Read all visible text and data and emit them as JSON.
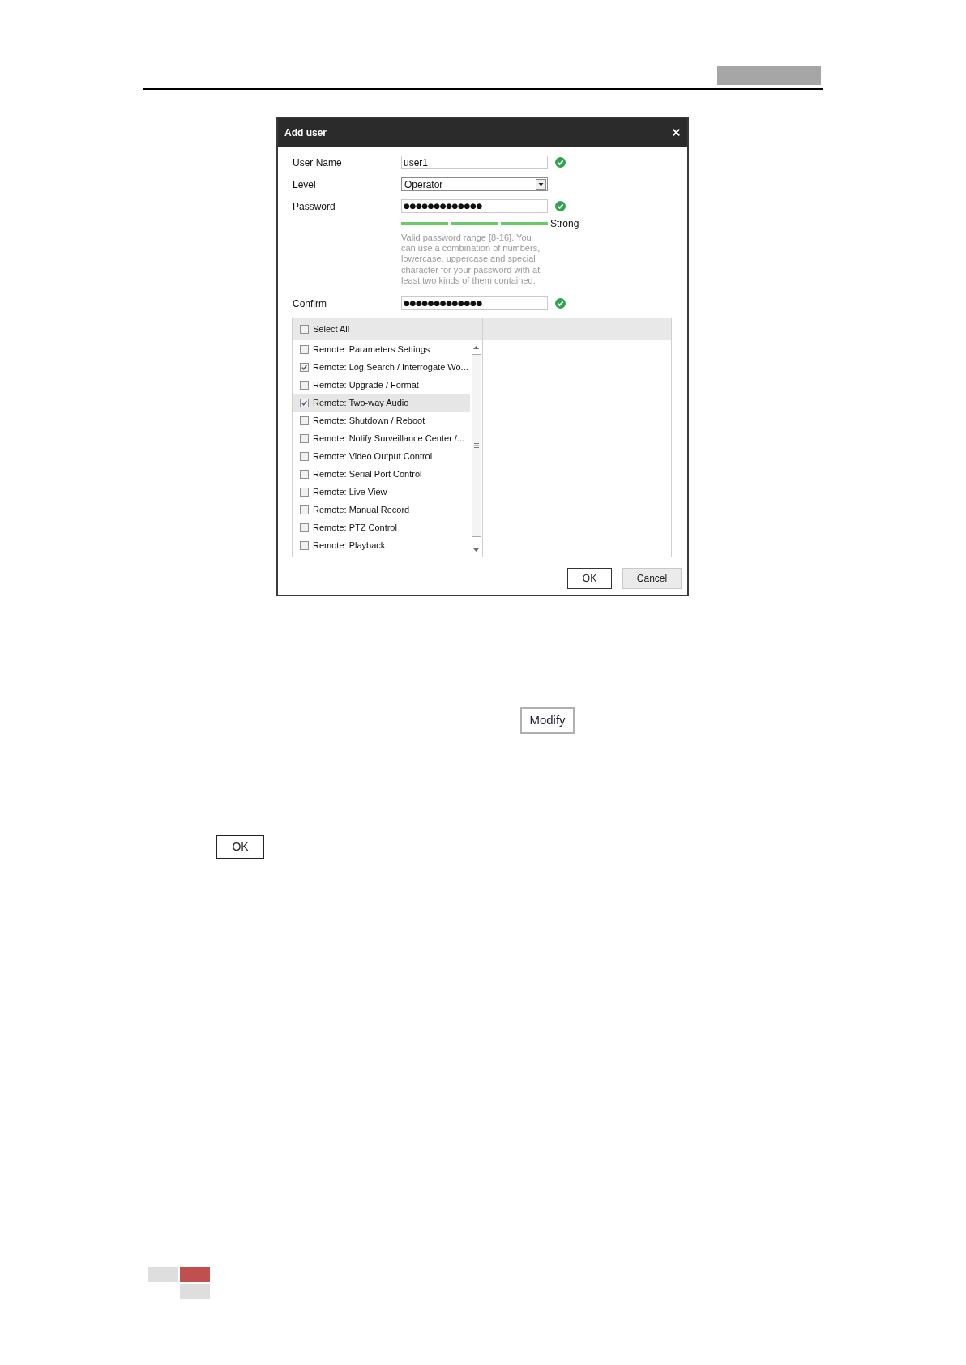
{
  "dialog": {
    "title": "Add user",
    "fields": [
      {
        "kind": "text",
        "label": "User Name",
        "value": "user1",
        "valid": true
      },
      {
        "kind": "select",
        "label": "Level",
        "value": "Operator"
      },
      {
        "kind": "password",
        "label": "Password",
        "value": "●●●●●●●●●●●●●",
        "valid": true
      }
    ],
    "strength": {
      "bars": [
        {
          "on": true
        },
        {
          "on": true
        },
        {
          "on": true
        }
      ],
      "label": "Strong"
    },
    "hint": "Valid password range [8-16]. You can use a combination of numbers, lowercase, uppercase and special character for your password with at least two kinds of them contained.",
    "confirm_field": {
      "kind": "password",
      "label": "Confirm",
      "value": "●●●●●●●●●●●●●",
      "valid": true
    },
    "select_all": {
      "label": "Select All",
      "checked": false
    },
    "permissions": [
      {
        "label": "Remote: Parameters Settings",
        "checked": false,
        "selected": false
      },
      {
        "label": "Remote: Log Search / Interrogate Wo...",
        "checked": true,
        "selected": false
      },
      {
        "label": "Remote: Upgrade / Format",
        "checked": false,
        "selected": false
      },
      {
        "label": "Remote: Two-way Audio",
        "checked": true,
        "selected": true
      },
      {
        "label": "Remote: Shutdown / Reboot",
        "checked": false,
        "selected": false
      },
      {
        "label": "Remote: Notify Surveillance Center /...",
        "checked": false,
        "selected": false
      },
      {
        "label": "Remote: Video Output Control",
        "checked": false,
        "selected": false
      },
      {
        "label": "Remote: Serial Port Control",
        "checked": false,
        "selected": false
      },
      {
        "label": "Remote: Live View",
        "checked": false,
        "selected": false
      },
      {
        "label": "Remote: Manual Record",
        "checked": false,
        "selected": false
      },
      {
        "label": "Remote: PTZ Control",
        "checked": false,
        "selected": false
      },
      {
        "label": "Remote: Playback",
        "checked": false,
        "selected": false
      }
    ],
    "buttons": [
      {
        "label": "OK",
        "kind": "default"
      },
      {
        "label": "Cancel",
        "kind": "normal"
      }
    ]
  },
  "modify_button": {
    "label": "Modify"
  },
  "ok_button": {
    "label": "OK"
  }
}
